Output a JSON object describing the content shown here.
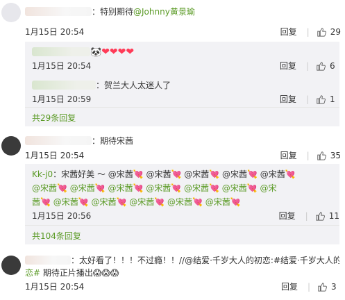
{
  "comments": [
    {
      "text": "：特别期待",
      "mention": "@Johnny黄景瑜",
      "time": "1月15日 20:54",
      "reply_label": "回复",
      "like_count": "29",
      "replies": [
        {
          "text": "❤❤❤❤",
          "time": "1月15日 20:54",
          "reply_label": "回复",
          "like_count": "6"
        },
        {
          "text": "：贺兰大人太迷人了",
          "time": "1月15日 20:59",
          "reply_label": "回复",
          "like_count": "1"
        }
      ],
      "more_replies": "共29条回复"
    },
    {
      "text": "：期待宋茜",
      "time": "1月15日 20:54",
      "reply_label": "回复",
      "like_count": "35",
      "replies": [
        {
          "user": "Kk-j0",
          "text_line1": "：宋茜好美 ～ @宋茜💘 @宋茜💘 @宋茜💘 @宋茜💘 @宋茜💘",
          "text_line2": "@宋茜💘 @宋茜💘 @宋茜💘 @宋茜💘 @宋茜💘 @宋茜💘 @宋",
          "text_line3": "茜💘 @宋茜💘 @宋茜💘 @宋茜💘 @宋茜💘 @宋茜💘",
          "time": "1月15日 20:56",
          "reply_label": "回复",
          "like_count": "11"
        }
      ],
      "more_replies": "共104条回复"
    },
    {
      "text_line1": "：太好看了！！！不过瘾！！//@结爱·千岁大人的初恋:#结爱·千岁大人的初",
      "text_line2_link": "恋#",
      "text_line2": " 期待正片播出😱😱😱",
      "time": "1月15日 20:54",
      "reply_label": "回复",
      "like_count": "3"
    }
  ]
}
